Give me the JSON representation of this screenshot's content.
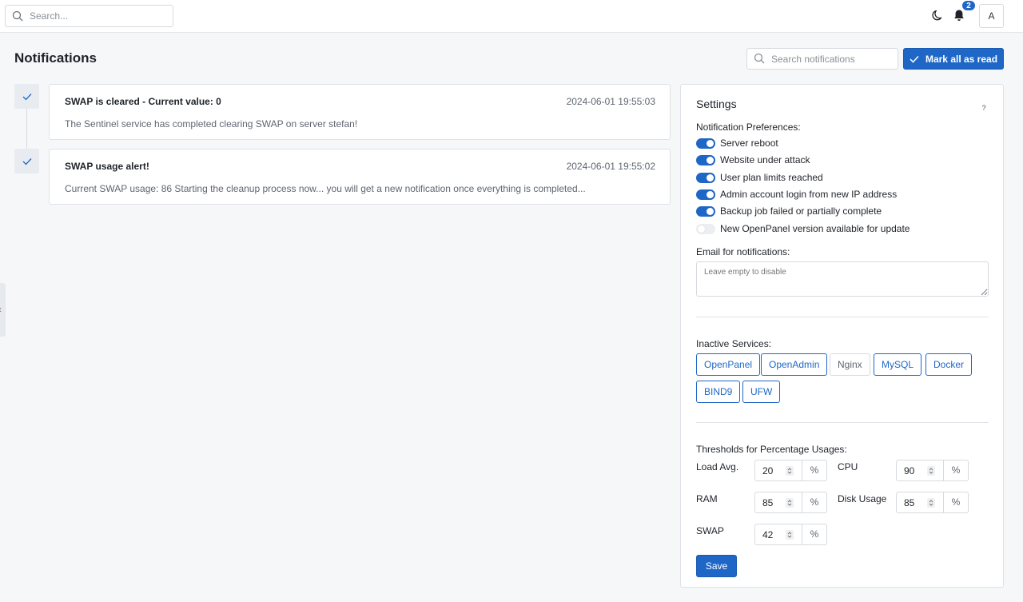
{
  "topbar": {
    "search_placeholder": "Search...",
    "notification_count": "2",
    "avatar_initial": "A"
  },
  "page": {
    "title": "Notifications",
    "search_placeholder": "Search notifications",
    "mark_all_label": "Mark all as read"
  },
  "notifications": [
    {
      "title": "SWAP is cleared - Current value: 0",
      "date": "2024-06-01 19:55:03",
      "message": "The Sentinel service has completed clearing SWAP on server stefan!"
    },
    {
      "title": "SWAP usage alert!",
      "date": "2024-06-01 19:55:02",
      "message": "Current SWAP usage: 86 Starting the cleanup process now... you will get a new notification once everything is completed..."
    }
  ],
  "settings": {
    "title": "Settings",
    "help": "?",
    "preferences_label": "Notification Preferences:",
    "preferences": [
      {
        "label": "Server reboot",
        "enabled": true
      },
      {
        "label": "Website under attack",
        "enabled": true
      },
      {
        "label": "User plan limits reached",
        "enabled": true
      },
      {
        "label": "Admin account login from new IP address",
        "enabled": true
      },
      {
        "label": "Backup job failed or partially complete",
        "enabled": true
      },
      {
        "label": "New OpenPanel version available for update",
        "enabled": false
      }
    ],
    "email_label": "Email for notifications:",
    "email_placeholder": "Leave empty to disable",
    "services_label": "Inactive Services:",
    "services": [
      {
        "label": "OpenPanel",
        "active": true
      },
      {
        "label": "OpenAdmin",
        "active": true
      },
      {
        "label": "Nginx",
        "active": false
      },
      {
        "label": "MySQL",
        "active": true
      },
      {
        "label": "Docker",
        "active": true
      },
      {
        "label": "BIND9",
        "active": true
      },
      {
        "label": "UFW",
        "active": true
      }
    ],
    "thresholds_label": "Thresholds for Percentage Usages:",
    "thresholds": {
      "load_avg": {
        "label": "Load Avg.",
        "value": "20",
        "unit": "%"
      },
      "cpu": {
        "label": "CPU",
        "value": "90",
        "unit": "%"
      },
      "ram": {
        "label": "RAM",
        "value": "85",
        "unit": "%"
      },
      "disk": {
        "label": "Disk Usage",
        "value": "85",
        "unit": "%"
      },
      "swap": {
        "label": "SWAP",
        "value": "42",
        "unit": "%"
      }
    },
    "save_label": "Save"
  },
  "colors": {
    "accent": "#1f67c7",
    "toggle_off": "#eceef1"
  }
}
